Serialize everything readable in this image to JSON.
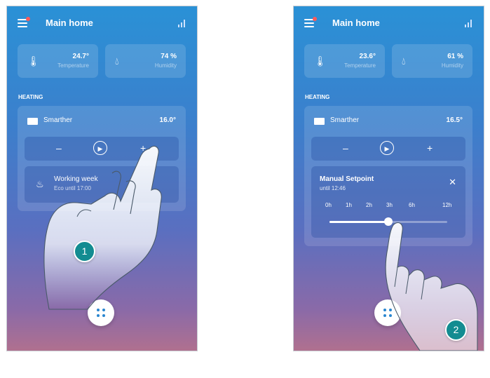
{
  "screens": [
    {
      "header": {
        "title": "Main home"
      },
      "temperature": {
        "value": "24.7°",
        "label": "Temperature"
      },
      "humidity": {
        "value": "74 %",
        "label": "Humidity"
      },
      "section_title": "HEATING",
      "device": {
        "name": "Smarther",
        "temperature": "16.0°"
      },
      "controls": {
        "minus": "–",
        "plus": "+"
      },
      "program": {
        "name": "Working week",
        "subtitle": "Eco until 17:00"
      },
      "step_badge": "1"
    },
    {
      "header": {
        "title": "Main home"
      },
      "temperature": {
        "value": "23.6°",
        "label": "Temperature"
      },
      "humidity": {
        "value": "61 %",
        "label": "Humidity"
      },
      "section_title": "HEATING",
      "device": {
        "name": "Smarther",
        "temperature": "16.5°"
      },
      "controls": {
        "minus": "–",
        "plus": "+"
      },
      "setpoint": {
        "title": "Manual Setpoint",
        "until": "until 12:46",
        "close": "✕",
        "durations": [
          "0h",
          "1h",
          "2h",
          "3h",
          "6h",
          "12h"
        ],
        "slider_fraction": 0.5
      },
      "step_badge": "2"
    }
  ]
}
